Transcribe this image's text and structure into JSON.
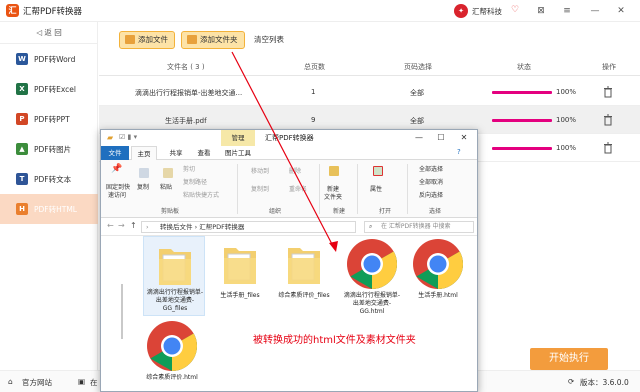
{
  "app": {
    "title": "汇帮PDF转换器",
    "brand": "汇帮科技",
    "logo_glyph": "汇",
    "accent_color": "#ea5413"
  },
  "sidebar": {
    "back_label": "◁ 返 回",
    "items": [
      {
        "label": "PDF转Word",
        "icon": "word-icon",
        "color": "#2b579a",
        "glyph": "W"
      },
      {
        "label": "PDF转Excel",
        "icon": "excel-icon",
        "color": "#217346",
        "glyph": "X"
      },
      {
        "label": "PDF转PPT",
        "icon": "ppt-icon",
        "color": "#d24726",
        "glyph": "P"
      },
      {
        "label": "PDF转图片",
        "icon": "image-icon",
        "color": "#3c8d3c",
        "glyph": "▲"
      },
      {
        "label": "PDF转文本",
        "icon": "text-icon",
        "color": "#2f5597",
        "glyph": "T"
      },
      {
        "label": "PDF转HTML",
        "icon": "html-icon",
        "color": "#ea7f2e",
        "glyph": "H",
        "active": true
      }
    ]
  },
  "toolbar": {
    "add_file": "添加文件",
    "add_folder": "添加文件夹",
    "clear_list": "清空列表"
  },
  "table": {
    "headers": {
      "name": "文件名 ( 3 )",
      "pages": "总页数",
      "page_select": "页码选择",
      "status": "状态",
      "ops": "操作"
    },
    "rows": [
      {
        "name": "滴滴出行行程报销单-出差地交通...",
        "pages": "1",
        "page_select": "全部",
        "progress": "100%"
      },
      {
        "name": "生活手册.pdf",
        "pages": "9",
        "page_select": "全部",
        "progress": "100%"
      },
      {
        "name": "",
        "pages": "",
        "page_select": "",
        "progress": "100%"
      }
    ]
  },
  "footer": {
    "website": "官方网站",
    "online": "在",
    "start": "开始执行",
    "version": "版本：3.6.0.0"
  },
  "explorer": {
    "manage_tab": "管理",
    "title": "汇帮PDF转换器",
    "tabs": [
      "文件",
      "主页",
      "共享",
      "查看",
      "图片工具"
    ],
    "ribbon": {
      "pin": "固定到快",
      "pin2": "速访问",
      "copy": "复制",
      "paste": "粘贴",
      "cut": "剪切",
      "copy_path": "复制路径",
      "paste_shortcut": "粘贴快捷方式",
      "clipboard": "剪贴板",
      "move_to": "移动到",
      "copy_to": "复制到",
      "delete": "删除",
      "rename": "重命名",
      "organize": "组织",
      "new_folder": "新建",
      "new_folder2": "文件夹",
      "new": "新建",
      "properties": "属性",
      "open": "打开",
      "select_all": "全部选择",
      "select_none": "全部取消",
      "invert": "反向选择",
      "select": "选择"
    },
    "address": "转换后文件 › 汇帮PDF转换器",
    "search_placeholder": "在 汇帮PDF转换器 中搜索",
    "files": [
      {
        "label": "滴滴出行行程报销单-出差地交通费-GG_files",
        "type": "folder"
      },
      {
        "label": "生活手册_files",
        "type": "folder"
      },
      {
        "label": "综合素质评价_files",
        "type": "folder"
      },
      {
        "label": "滴滴出行行程报销单-出差地交通费-GG.html",
        "type": "html"
      },
      {
        "label": "生活手册.html",
        "type": "html"
      },
      {
        "label": "综合素质评价.html",
        "type": "html"
      }
    ]
  },
  "annotation": "被转换成功的html文件及素材文件夹"
}
